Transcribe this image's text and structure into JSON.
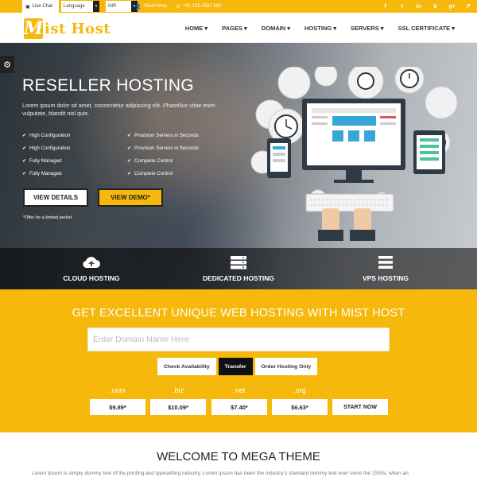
{
  "topbar": {
    "live_chat": "Live Chat",
    "language": "Language",
    "currency": "INR",
    "client_area": "Client Area",
    "phone": "+91 123 4567 890",
    "social": [
      "f",
      "t",
      "in",
      "b",
      "g+",
      "P"
    ]
  },
  "header": {
    "logo_letter": "M",
    "logo_text": "ist Host",
    "nav": [
      "HOME ▾",
      "PAGES ▾",
      "DOMAIN ▾",
      "HOSTING ▾",
      "SERVERS ▾",
      "SSL CERTIFICATE ▾"
    ]
  },
  "hero": {
    "title": "RESELLER HOSTING",
    "description": "Lorem ipsum dolor sit amet, consectetur adipiscing elit. Phasellus vitae enim vulputate, blandit nisl quis.",
    "features": [
      "High Configuration",
      "Provision Servers in Seconds",
      "High Configuration",
      "Provision Servers in Seconds",
      "Fully Managed",
      "Complete Control",
      "Fully Managed",
      "Complete Control"
    ],
    "btn_details": "VIEW DETAILS",
    "btn_demo": "VIEW DEMO*",
    "offer": "*Offer for a limited period"
  },
  "strip": {
    "items": [
      "CLOUD HOSTING",
      "DEDICATED HOSTING",
      "VPS HOSTING"
    ]
  },
  "domain": {
    "heading": "GET EXCELLENT UNIQUE WEB HOSTING WITH MIST HOST",
    "placeholder": "Enter Domain Name Here",
    "options": [
      "Check Availability",
      "Transfer",
      "Order Hosting Only"
    ],
    "tlds": [
      {
        "ext": ".com",
        "price": "$9.89*"
      },
      {
        "ext": ".biz",
        "price": "$10.09*"
      },
      {
        "ext": ".net",
        "price": "$7.40*"
      },
      {
        "ext": ".org",
        "price": "$6.63*"
      }
    ],
    "start": "START NOW"
  },
  "welcome": {
    "title": "WELCOME TO MEGA THEME",
    "text": "Lorem Ipsum is simply dummy text of the printing and typesetting industry. Lorem Ipsum has been the industry's standard dummy text ever since the 1500s, when an"
  },
  "colors": {
    "accent": "#f6b80a",
    "dark": "#222222"
  }
}
